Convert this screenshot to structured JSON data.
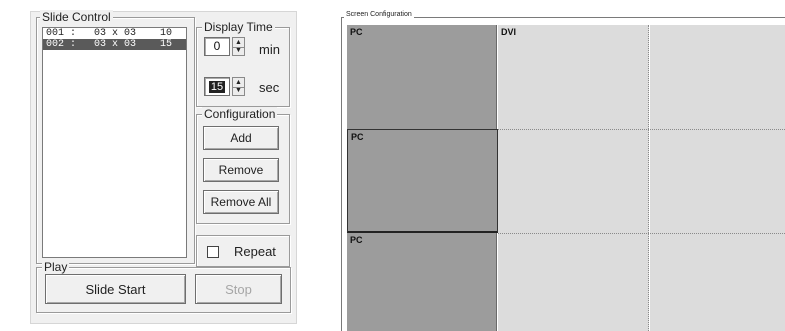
{
  "slide_control": {
    "title": "Slide Control",
    "slides": [
      {
        "label": "001 :   03 x 03    10",
        "selected": false
      },
      {
        "label": "002 :   03 x 03    15",
        "selected": true
      }
    ]
  },
  "display_time": {
    "title": "Display Time",
    "min_value": "0",
    "min_unit": "min",
    "sec_value": "15",
    "sec_unit": "sec"
  },
  "configuration": {
    "title": "Configuration",
    "add_label": "Add",
    "remove_label": "Remove",
    "remove_all_label": "Remove All"
  },
  "repeat": {
    "label": "Repeat",
    "checked": false
  },
  "play": {
    "title": "Play",
    "start_label": "Slide Start",
    "stop_label": "Stop"
  },
  "screen_config": {
    "title": "Screen Configuration",
    "rows": [
      {
        "left": "PC",
        "right": "DVI"
      },
      {
        "left": "PC",
        "right": ""
      },
      {
        "left": "PC",
        "right": ""
      }
    ]
  },
  "colors": {
    "pc_cell": "#9c9c9c",
    "dvi_cell": "#dcdcdc",
    "selection": "#5a5a5a"
  }
}
